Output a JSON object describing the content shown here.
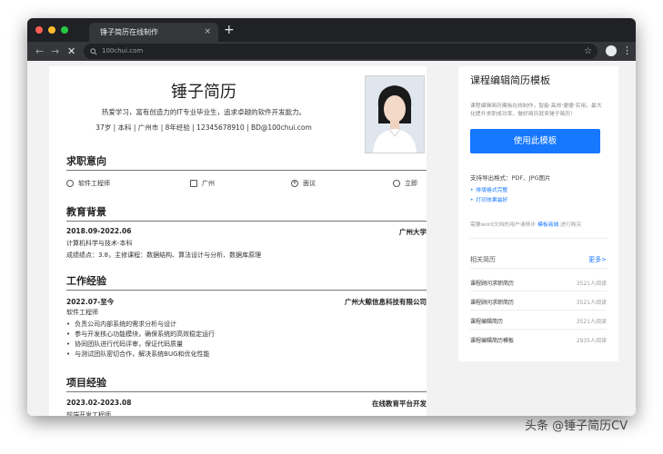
{
  "browser": {
    "tab_title": "锤子简历在线制作",
    "tab_close": "×",
    "new_tab": "+",
    "url": "100chui.com",
    "back": "←",
    "forward": "→",
    "stop": "✕",
    "star": "☆",
    "menu": "⋮"
  },
  "resume": {
    "name": "锤子简历",
    "motto": "热爱学习，富有创造力的IT专业毕业生，追求卓越的软件开发能力。",
    "info": "37岁 | 本科 | 广州市 | 8年经验 | 12345678910 | BD@100chui.com",
    "sections": {
      "intent": "求职意向",
      "education": "教育背景",
      "work": "工作经验",
      "project": "项目经验"
    },
    "intent": {
      "job": "软件工程师",
      "city": "广州",
      "salary": "面议",
      "availability": "立即"
    },
    "education": {
      "date": "2018.09-2022.06",
      "school": "广州大学",
      "major": "计算机科学与技术-本科",
      "detail": "成绩绩点：3.8，主修课程：数据结构、算法设计与分析、数据库原理"
    },
    "work": {
      "date": "2022.07-至今",
      "company": "广州大鲸信息科技有限公司",
      "role": "软件工程师",
      "bullets": [
        "负责公司内部系统的需求分析与设计",
        "参与开发核心功能模块，确保系统的高效稳定运行",
        "协同团队进行代码评审，保证代码质量",
        "与测试团队密切合作，解决系统BUG和优化性能"
      ]
    },
    "project": {
      "date": "2023.02-2023.08",
      "name": "在线教育平台开发",
      "role": "前端开发工程师"
    }
  },
  "sidebar": {
    "title": "课程编辑简历模板",
    "desc": "课程编辑简历模板在线制作，智能·高效·便捷·实用，最大化提升求职成功率，做好简历就来锤子简历！",
    "use_button": "使用此模板",
    "export": "支持导出格式：PDF、JPG图片",
    "features": [
      "排版格式完整",
      "打印效果最好"
    ],
    "note_prefix": "需要word文档的用户请移步",
    "note_link": "模板商城",
    "note_suffix": "进行购买",
    "related_title": "相关简历",
    "related_more": "更多>",
    "related": [
      {
        "name": "课程顾问求职简历",
        "count": "3521人阅读"
      },
      {
        "name": "课程顾问求职简历",
        "count": "3521人阅读"
      },
      {
        "name": "课程编辑简历",
        "count": "3521人阅读"
      },
      {
        "name": "课程编辑简历模板",
        "count": "2935人阅读"
      }
    ]
  },
  "watermark": "头条 @锤子简历CV",
  "colors": {
    "accent": "#1677ff",
    "titlebar": "#202124",
    "toolbar": "#35363a"
  }
}
